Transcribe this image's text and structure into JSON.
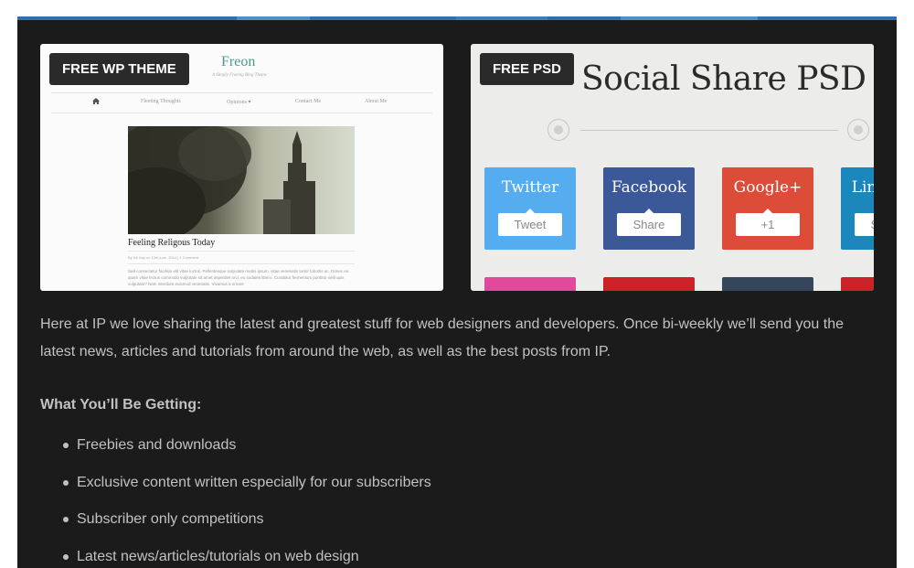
{
  "colors": {
    "panel_bg": "#1b1b1b",
    "accent_bar": [
      "#2f6fb2",
      "#4b8fcb",
      "#2f6fb2",
      "#3a7fc0",
      "#2f6fb2",
      "#4b8fcb",
      "#2f6fb2"
    ],
    "text": "#c2c2c2"
  },
  "cards": [
    {
      "badge": "FREE WP THEME",
      "blog": {
        "title": "Freon",
        "tagline": "A Simply Freeing Blog Theme",
        "nav": [
          "Fleeting Thoughts",
          "Opinions ▾",
          "Contact Me",
          "About Me"
        ],
        "home_icon": "home-icon",
        "post_title": "Feeling Religous Today",
        "post_meta": "By lok Kay on 12th june, 2014 | 1 Comment",
        "post_body": "Sed consectetur facilisis elit vitae luctus. Pellentesque vulputate mattis ipsum, vitae venenatis tortor lobortis ac. Donec eu quam vitae lectus commodo vulputate sit amet imperdiet orci, eu sodales libero. Curabitur fermentum porttitor velit quis vulputate? Nam interdum euismod venenatis. Vivamus a ornare"
      }
    },
    {
      "badge": "FREE PSD",
      "psd": {
        "title": "Social Share PSD",
        "buttons": [
          {
            "name": "Twitter",
            "action": "Tweet",
            "color": "#55acee",
            "stub": "#e14a9a"
          },
          {
            "name": "Facebook",
            "action": "Share",
            "color": "#3b5998",
            "stub": "#cc2127"
          },
          {
            "name": "Google+",
            "action": "+1",
            "color": "#dd4b39",
            "stub": "#35465c"
          },
          {
            "name": "LinkedIn",
            "action": "Share",
            "color": "#1c87bd",
            "stub": "#cc2127"
          }
        ]
      }
    }
  ],
  "intro": "Here at IP we love sharing the latest and greatest stuff for web designers and developers. Once bi-weekly we’ll send you the latest news, articles and tutorials from around the web, as well as the best posts from IP.",
  "heading": "What You’ll Be Getting:",
  "benefits": [
    "Freebies and downloads",
    "Exclusive content written especially for our subscribers",
    "Subscriber only competitions",
    "Latest news/articles/tutorials on web design"
  ]
}
